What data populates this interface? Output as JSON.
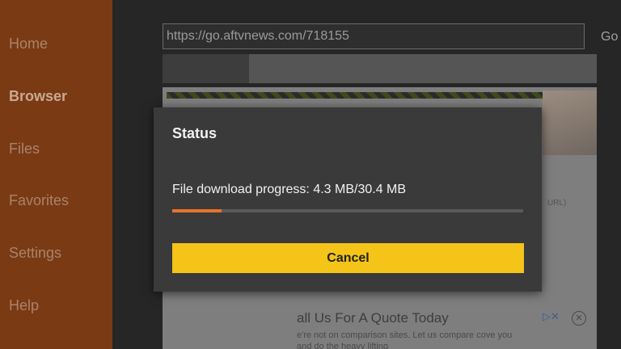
{
  "sidebar": {
    "items": [
      {
        "label": "Home"
      },
      {
        "label": "Browser",
        "active": true
      },
      {
        "label": "Files"
      },
      {
        "label": "Favorites"
      },
      {
        "label": "Settings"
      },
      {
        "label": "Help"
      }
    ]
  },
  "browser": {
    "url": "https://go.aftvnews.com/718155",
    "go_label": "Go"
  },
  "webpage": {
    "stub_text": "URL)",
    "ad_headline": "all Us For A Quote Today",
    "ad_subtext": "e're not on comparison sites. Let us compare cove you and do the heavy lifting"
  },
  "dialog": {
    "title": "Status",
    "progress_text": "File download progress: 4.3 MB/30.4 MB",
    "progress_fraction": 0.1414,
    "cancel_label": "Cancel"
  },
  "colors": {
    "sidebar": "#7a3a14",
    "progress_fill": "#e9722c",
    "cancel_button": "#f4c419"
  }
}
